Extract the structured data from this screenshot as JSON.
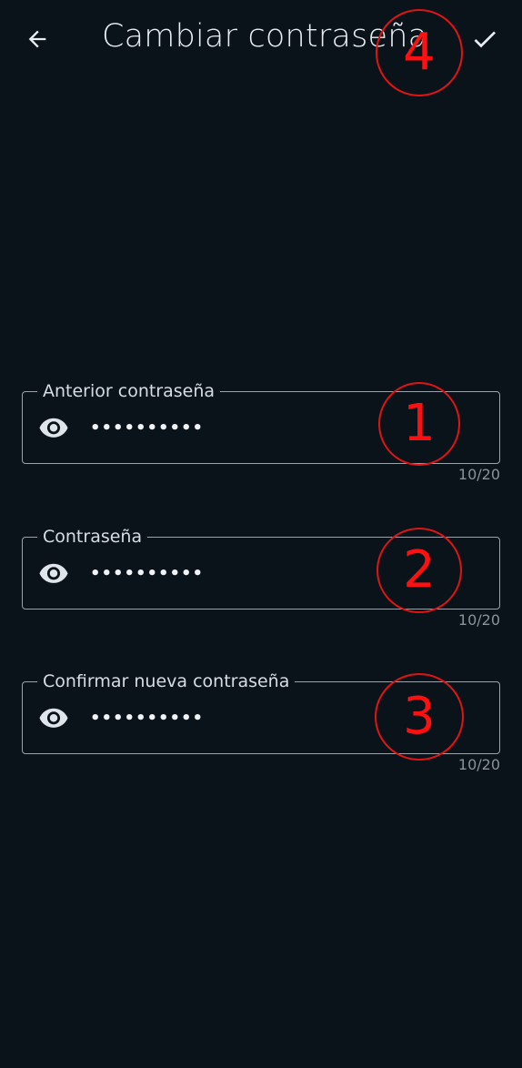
{
  "header": {
    "title": "Cambiar contraseña",
    "back_icon": "arrow-left-icon",
    "confirm_icon": "check-icon"
  },
  "fields": [
    {
      "label": "Anterior contraseña",
      "value": "••••••••••",
      "counter": "10/20",
      "icon": "eye-icon"
    },
    {
      "label": "Contraseña",
      "value": "••••••••••",
      "counter": "10/20",
      "icon": "eye-icon"
    },
    {
      "label": "Confirmar nueva contraseña",
      "value": "••••••••••",
      "counter": "10/20",
      "icon": "eye-icon"
    }
  ],
  "annotations": [
    "1",
    "2",
    "3",
    "4"
  ],
  "colors": {
    "background": "#0b131a",
    "text": "#e8edf2",
    "border": "#9aa3ab",
    "annotation": "#e01414"
  }
}
